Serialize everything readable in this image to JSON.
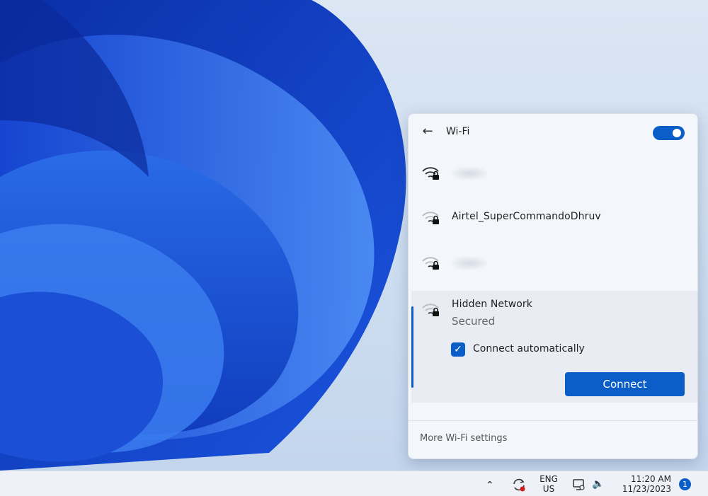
{
  "wifi_panel": {
    "title": "Wi-Fi",
    "toggle_state": "on",
    "networks": [
      {
        "name": "",
        "icon": "wifi-secured-icon"
      },
      {
        "name": "Airtel_SuperCommandoDhruv",
        "icon": "wifi-secured-icon"
      },
      {
        "name": "",
        "icon": "wifi-secured-icon"
      },
      {
        "name": "Hidden Network",
        "status": "Secured",
        "icon": "wifi-secured-icon"
      }
    ],
    "connect_automatically_label": "Connect automatically",
    "connect_automatically_checked": true,
    "connect_button": "Connect",
    "more_settings": "More Wi-Fi settings"
  },
  "taskbar": {
    "language": "ENG",
    "region": "US",
    "time": "11:20 AM",
    "date": "11/23/2023",
    "notification_count": "1"
  },
  "colors": {
    "accent": "#0b5ec7"
  }
}
